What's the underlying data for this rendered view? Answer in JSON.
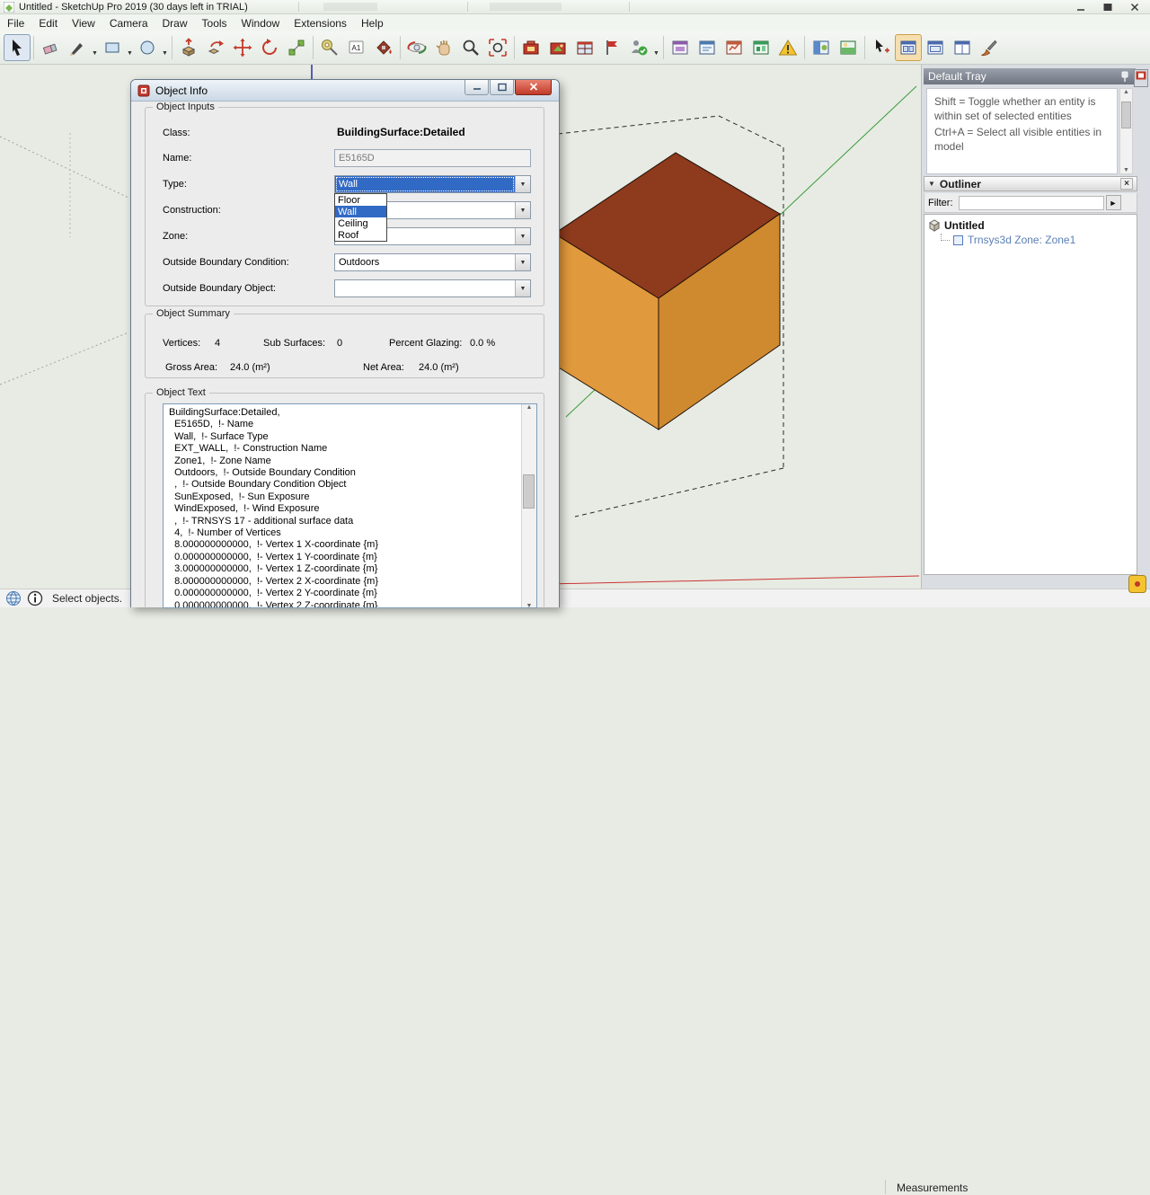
{
  "icons": {
    "caret_down": "▼",
    "caret_up": "▲",
    "close": "×",
    "filter_arrow": "►"
  },
  "window": {
    "title": "Untitled - SketchUp Pro 2019 (30 days left in TRIAL)"
  },
  "menu": {
    "items": [
      "File",
      "Edit",
      "View",
      "Camera",
      "Draw",
      "Tools",
      "Window",
      "Extensions",
      "Help"
    ]
  },
  "toolbar": {
    "text_tool_glyph": "A1"
  },
  "canvas": {
    "colors": {
      "background": "#e7ebe3",
      "model_top": "#8e3a1d",
      "model_front_left": "#e0993c",
      "model_front_right": "#cf8a2f",
      "axis_red": "#cc3333",
      "axis_green": "#3a9a3a",
      "axis_blue": "#2b2bb0",
      "selection_highlight": "#316ac5"
    }
  },
  "dialog": {
    "title": "Object Info",
    "inputs": {
      "legend": "Object Inputs",
      "class_label": "Class:",
      "class_value": "BuildingSurface:Detailed",
      "name_label": "Name:",
      "name_value": "E5165D",
      "type_label": "Type:",
      "type_value": "Wall",
      "type_options": [
        "Floor",
        "Wall",
        "Ceiling",
        "Roof"
      ],
      "construction_label": "Construction:",
      "construction_value": "",
      "zone_label": "Zone:",
      "zone_value": "",
      "obc_label": "Outside Boundary Condition:",
      "obc_value": "Outdoors",
      "obo_label": "Outside Boundary Object:",
      "obo_value": ""
    },
    "summary": {
      "legend": "Object Summary",
      "vertices_label": "Vertices:",
      "vertices_value": "4",
      "subsurfaces_label": "Sub Surfaces:",
      "subsurfaces_value": "0",
      "glazing_label": "Percent Glazing:",
      "glazing_value": "0.0 %",
      "gross_label": "Gross Area:",
      "gross_value": "24.0 (m²)",
      "net_label": "Net Area:",
      "net_value": "24.0 (m²)"
    },
    "text": {
      "legend": "Object Text",
      "content": "BuildingSurface:Detailed,\n  E5165D,  !- Name\n  Wall,  !- Surface Type\n  EXT_WALL,  !- Construction Name\n  Zone1,  !- Zone Name\n  Outdoors,  !- Outside Boundary Condition\n  ,  !- Outside Boundary Condition Object\n  SunExposed,  !- Sun Exposure\n  WindExposed,  !- Wind Exposure\n  ,  !- TRNSYS 17 - additional surface data\n  4,  !- Number of Vertices\n  8.000000000000,  !- Vertex 1 X-coordinate {m}\n  0.000000000000,  !- Vertex 1 Y-coordinate {m}\n  3.000000000000,  !- Vertex 1 Z-coordinate {m}\n  8.000000000000,  !- Vertex 2 X-coordinate {m}\n  0.000000000000,  !- Vertex 2 Y-coordinate {m}\n  0.000000000000,  !- Vertex 2 Z-coordinate {m}"
    }
  },
  "tray": {
    "title": "Default Tray",
    "instructions": [
      "Shift = Toggle whether an entity is within set of selected entities",
      "Ctrl+A = Select all visible entities in model"
    ],
    "outliner": {
      "title": "Outliner",
      "filter_label": "Filter:",
      "filter_value": "",
      "root_label": "Untitled",
      "child_label": "Trnsys3d Zone:  Zone1"
    }
  },
  "statusbar": {
    "hint": "Select objects.",
    "measurements_label": "Measurements"
  }
}
